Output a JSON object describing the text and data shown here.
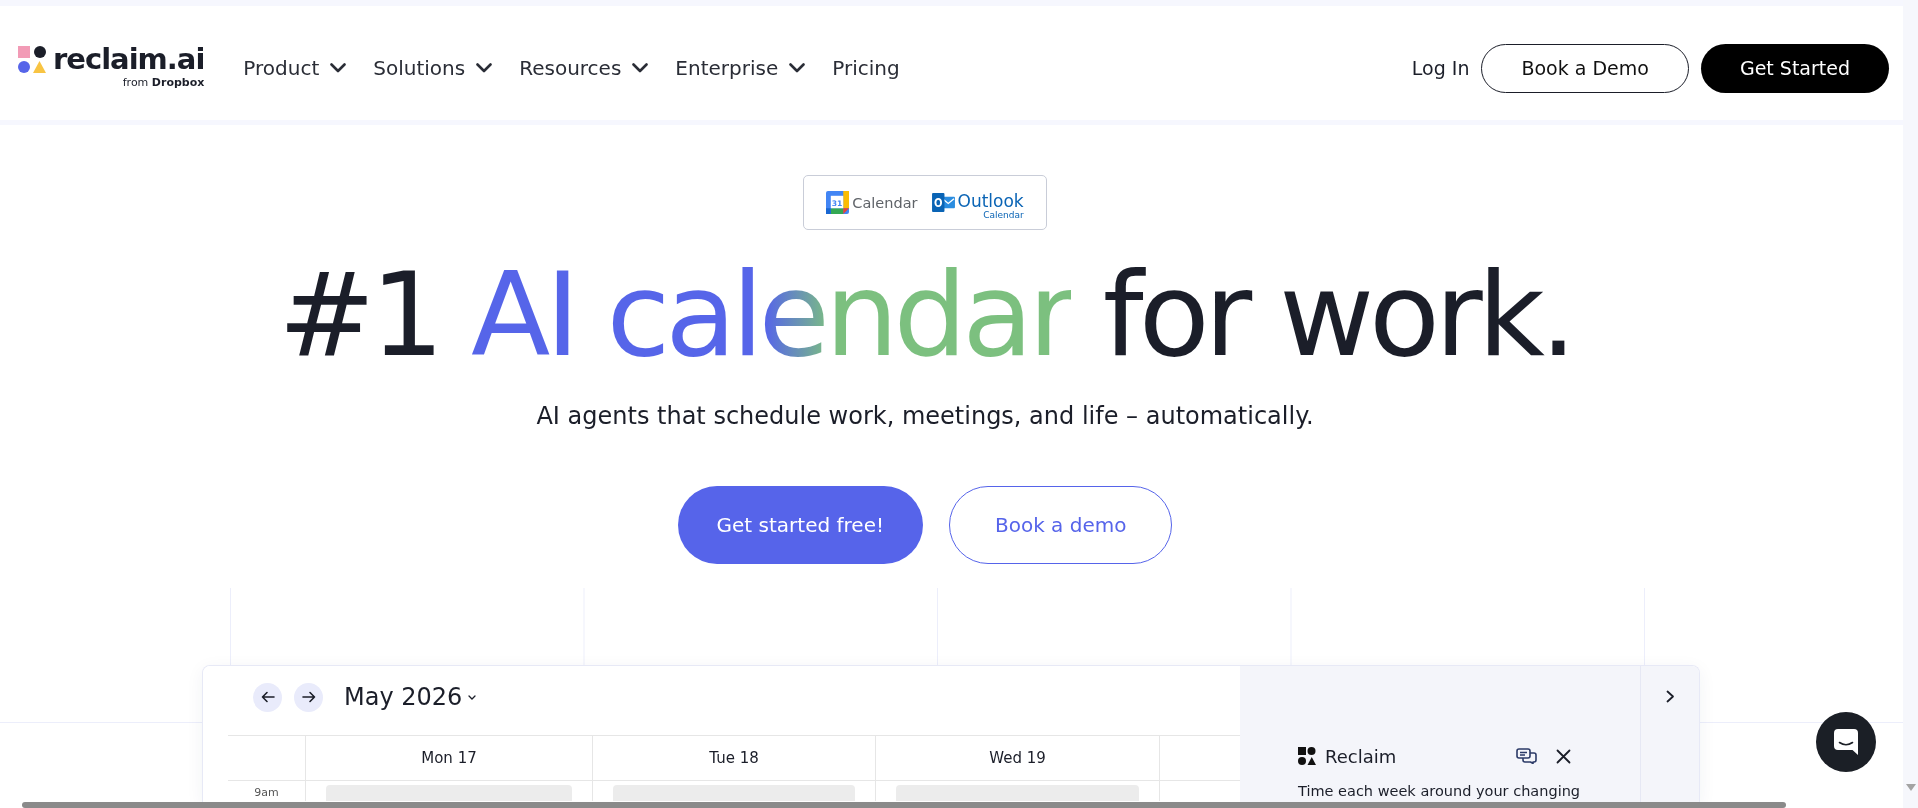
{
  "nav": {
    "logo": {
      "wordmark": "reclaim.ai",
      "tagline": "from **Dropbox**"
    },
    "menu": [
      {
        "label": "Product",
        "has_dropdown": true
      },
      {
        "label": "Solutions",
        "has_dropdown": true
      },
      {
        "label": "Resources",
        "has_dropdown": true
      },
      {
        "label": "Enterprise",
        "has_dropdown": true
      },
      {
        "label": "Pricing",
        "has_dropdown": false
      }
    ],
    "actions": [
      {
        "label": "Log In",
        "kind": "link"
      },
      {
        "label": "Book a Demo",
        "kind": "outline"
      },
      {
        "label": "Get Started",
        "kind": "solid"
      }
    ]
  },
  "hero": {
    "integrations": [
      {
        "kind": "google",
        "icon_text": "31",
        "label": "Calendar"
      },
      {
        "kind": "outlook",
        "label": "Outlook",
        "sublabel": "Calendar"
      }
    ],
    "headline": [
      {
        "text": "#1 ",
        "kind": "plain"
      },
      {
        "text": "AI calendar",
        "kind": "gradient"
      },
      {
        "text": " for work.",
        "kind": "plain"
      }
    ],
    "subtitle": "AI agents that schedule work, meetings, and life – automatically.",
    "buttons": [
      {
        "label": "Get started free!",
        "kind": "primary"
      },
      {
        "label": "Book a demo",
        "kind": "secondary"
      }
    ]
  },
  "calendar_preview": {
    "month": "May 2026",
    "days": [
      {
        "label": "Mon 17"
      },
      {
        "label": "Tue 18"
      },
      {
        "label": "Wed 19"
      }
    ],
    "time_label": "9am",
    "assistant": {
      "title": "Reclaim",
      "message": "Time each week around your changing"
    }
  }
}
